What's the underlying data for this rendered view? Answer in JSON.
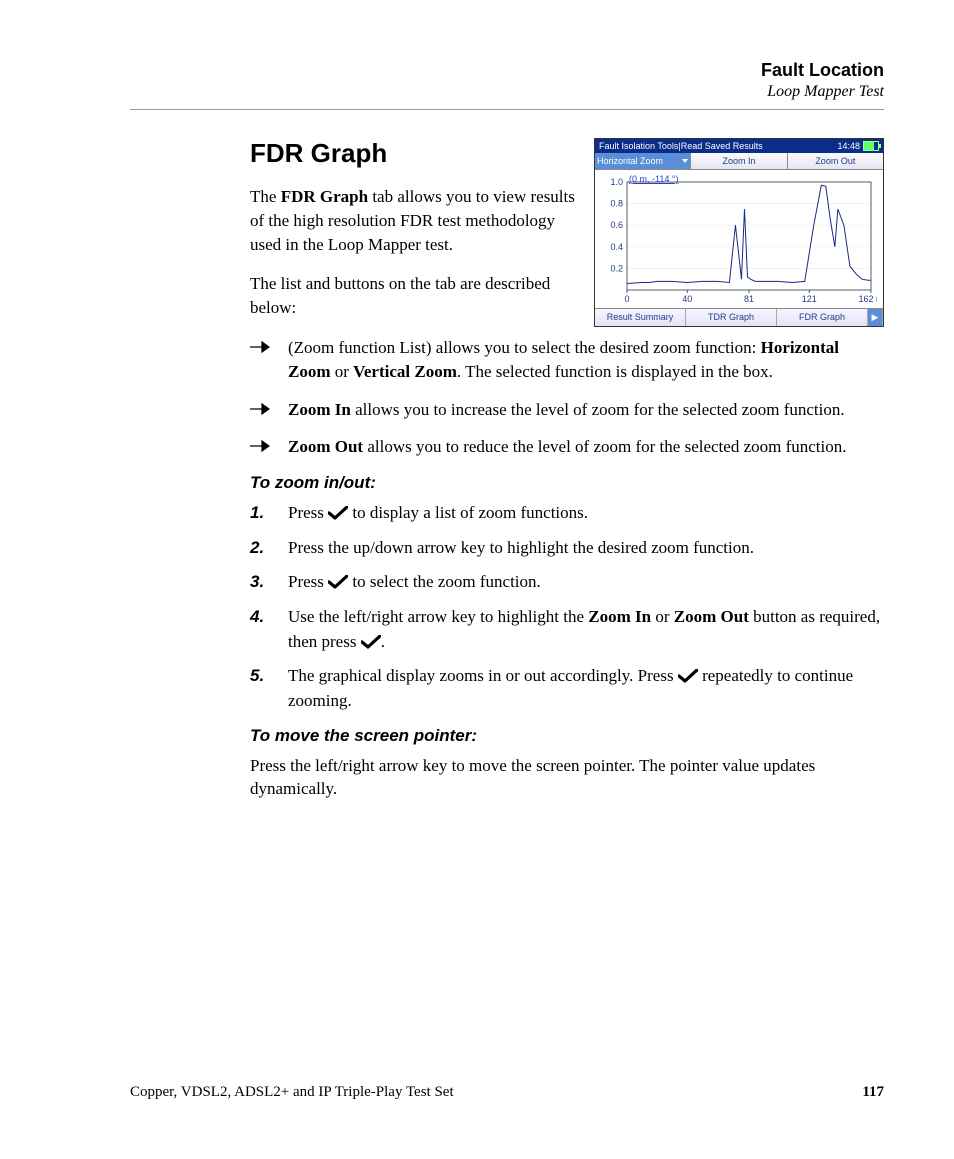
{
  "header": {
    "title": "Fault Location",
    "subtitle": "Loop Mapper Test"
  },
  "section_heading": "FDR Graph",
  "intro": {
    "p1_a": "The ",
    "p1_b": "FDR Graph",
    "p1_c": " tab allows you to view results of the high resolution FDR test methodology used in the Loop Mapper test.",
    "p2": "The list and buttons on the tab are described below:"
  },
  "bullets": {
    "b1_a": "(Zoom function List) allows you to select the desired zoom function: ",
    "b1_b": "Horizontal Zoom",
    "b1_c": " or ",
    "b1_d": "Vertical Zoom",
    "b1_e": ". The selected function is displayed in the box.",
    "b2_a": "Zoom In",
    "b2_b": " allows you to increase the level of zoom for the selected zoom function.",
    "b3_a": "Zoom Out",
    "b3_b": " allows you to reduce the level of zoom for the selected zoom function."
  },
  "proc1_heading": "To zoom in/out:",
  "proc1": {
    "s1_a": "Press ",
    "s1_b": " to display a list of zoom functions.",
    "s2": "Press the up/down arrow key to highlight the desired zoom function.",
    "s3_a": "Press ",
    "s3_b": " to select the zoom function.",
    "s4_a": "Use the left/right arrow key to highlight the ",
    "s4_b": "Zoom In",
    "s4_c": " or ",
    "s4_d": "Zoom Out",
    "s4_e": " button as required, then press ",
    "s4_f": ".",
    "s5_a": "The graphical display zooms in or out accordingly. Press ",
    "s5_b": " repeatedly to continue zooming."
  },
  "proc2_heading": "To move the screen pointer:",
  "proc2_text": "Press the left/right arrow key to move the screen pointer. The pointer value updates dynamically.",
  "footer": {
    "left": "Copper, VDSL2, ADSL2+ and IP Triple-Play Test Set",
    "page": "117"
  },
  "device": {
    "title": "Fault Isolation Tools|Read Saved Results",
    "time": "14:48",
    "toolbar": {
      "zoom_select": "Horizontal Zoom",
      "zoom_in": "Zoom In",
      "zoom_out": "Zoom Out"
    },
    "pointer_label": "(0 m, -114 °)",
    "tabs": {
      "t1": "Result Summary",
      "t2": "TDR Graph",
      "t3": "FDR Graph"
    }
  },
  "chart_data": {
    "type": "line",
    "title": "",
    "xlabel": "",
    "ylabel": "",
    "xlim": [
      0,
      162
    ],
    "ylim": [
      0,
      1.0
    ],
    "x_ticks": [
      0,
      40,
      81,
      121,
      162
    ],
    "x_tick_labels": [
      "0",
      "40",
      "81",
      "121",
      "162 m"
    ],
    "y_ticks": [
      0.2,
      0.4,
      0.6,
      0.8,
      1.0
    ],
    "series": [
      {
        "name": "FDR",
        "x": [
          0,
          10,
          15,
          20,
          30,
          40,
          50,
          60,
          68,
          72,
          76,
          78,
          80,
          82,
          85,
          90,
          100,
          110,
          118,
          124,
          129,
          132,
          135,
          138,
          140,
          144,
          148,
          152,
          156,
          160,
          162
        ],
        "values": [
          0.06,
          0.07,
          0.07,
          0.08,
          0.08,
          0.07,
          0.08,
          0.08,
          0.07,
          0.6,
          0.1,
          0.75,
          0.12,
          0.1,
          0.08,
          0.08,
          0.08,
          0.07,
          0.08,
          0.6,
          0.97,
          0.96,
          0.65,
          0.4,
          0.75,
          0.6,
          0.22,
          0.15,
          0.1,
          0.09,
          0.09
        ]
      }
    ]
  }
}
